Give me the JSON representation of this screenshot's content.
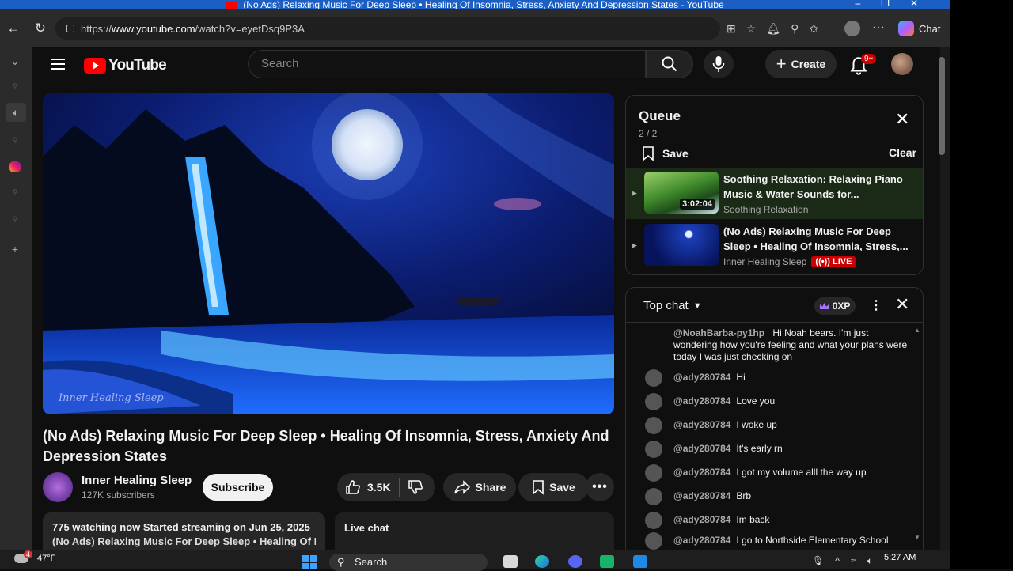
{
  "window": {
    "title": "(No Ads) Relaxing Music For Deep Sleep • Healing Of Insomnia, Stress, Anxiety And Depression States - YouTube"
  },
  "browser": {
    "url_prefix": "https://",
    "url_domain": "www.youtube.com",
    "url_path": "/watch?v=eyetDsq9P3A",
    "chat_label": "Chat"
  },
  "youtube": {
    "logo_text": "YouTube",
    "search_placeholder": "Search",
    "create_label": "Create",
    "notifications_badge": "9+"
  },
  "video": {
    "title": "(No Ads) Relaxing Music For Deep Sleep • Healing Of Insomnia, Stress, Anxiety And Depression States",
    "channel_name": "Inner Healing Sleep",
    "subscribers": "127K subscribers",
    "subscribe_label": "Subscribe",
    "likes": "3.5K",
    "share_label": "Share",
    "save_label": "Save",
    "watermark": "Inner Healing Sleep",
    "description_line1": "775 watching now  Started streaming on Jun 25, 2025",
    "description_line2": "(No Ads) Relaxing Music For Deep Sleep • Healing Of Insomnia, Stress...",
    "live_chat_tab": "Live chat"
  },
  "queue": {
    "title": "Queue",
    "count": "2 / 2",
    "save_label": "Save",
    "clear_label": "Clear",
    "items": [
      {
        "title": "Soothing Relaxation: Relaxing Piano Music & Water Sounds for...",
        "channel": "Soothing Relaxation",
        "duration": "3:02:04"
      },
      {
        "title": "(No Ads) Relaxing Music For Deep Sleep • Healing Of Insomnia, Stress,...",
        "channel": "Inner Healing Sleep",
        "live_label": "LIVE"
      }
    ]
  },
  "chat": {
    "mode_label": "Top chat",
    "xp_label": "0XP",
    "messages": [
      {
        "author": "@NoahBarba-py1hp",
        "text": "Hi Noah bears. I'm just wondering how you're feeling and what your plans were today I was just checking on"
      },
      {
        "author": "@ady280784",
        "text": "Hi"
      },
      {
        "author": "@ady280784",
        "text": "Love you"
      },
      {
        "author": "@ady280784",
        "text": "I woke up"
      },
      {
        "author": "@ady280784",
        "text": "It's early rn"
      },
      {
        "author": "@ady280784",
        "text": "I got my volume alll the way up"
      },
      {
        "author": "@ady280784",
        "text": "Brb"
      },
      {
        "author": "@ady280784",
        "text": "Im back"
      },
      {
        "author": "@ady280784",
        "text": "I go to Northside Elementary School"
      }
    ]
  },
  "taskbar": {
    "weather_temp": "47°F",
    "weather_badge": "4",
    "search_label": "Search",
    "time": "5:27 AM"
  },
  "colors": {
    "youtube_red": "#ff0000",
    "background": "#0f0f0f",
    "live_red": "#cc0000",
    "active_queue_item": "#1a2a16"
  }
}
